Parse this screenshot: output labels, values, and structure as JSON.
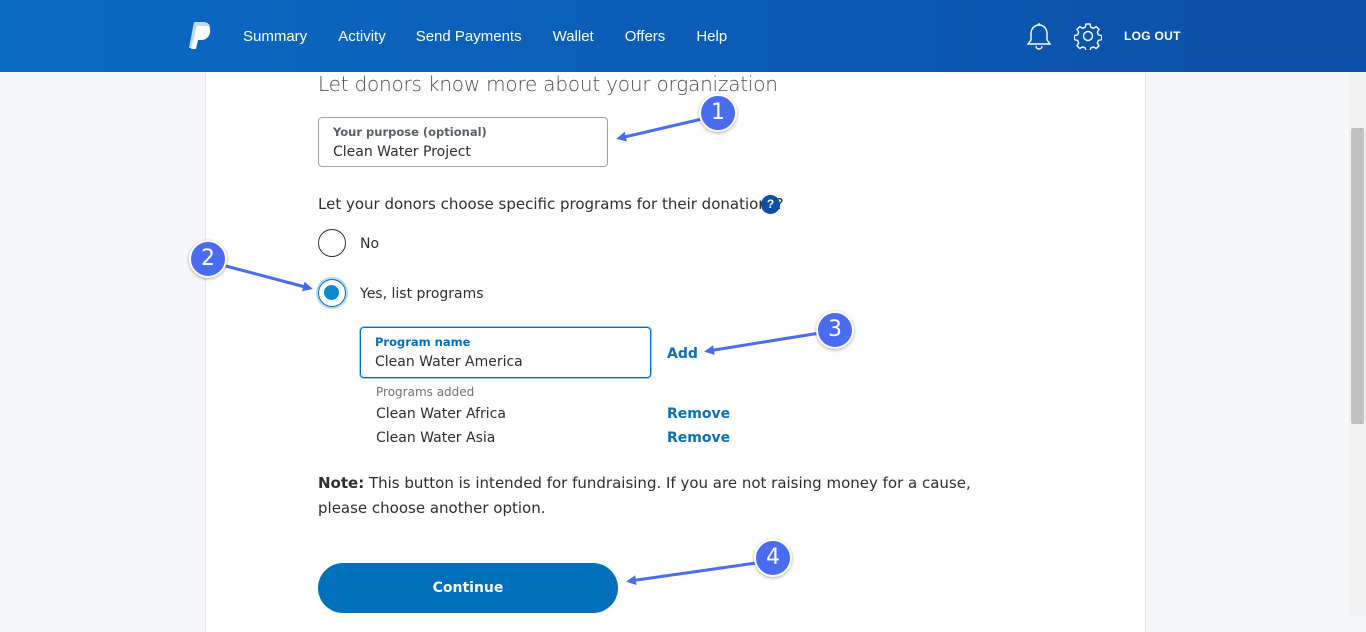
{
  "nav": {
    "items": [
      "Summary",
      "Activity",
      "Send Payments",
      "Wallet",
      "Offers",
      "Help"
    ],
    "logout_label": "LOG OUT",
    "logo_icon": "paypal-logo",
    "bell_icon": "bell-icon",
    "settings_icon": "gear-icon"
  },
  "form": {
    "heading": "Let donors know more about your organization",
    "purpose": {
      "label": "Your purpose (optional)",
      "value": "Clean Water Project"
    },
    "question": "Let your donors choose specific programs for their donations?",
    "help_icon": "?",
    "options": {
      "no": "No",
      "yes": "Yes, list programs",
      "selected": "yes"
    },
    "program": {
      "label": "Program name",
      "value": "Clean Water America",
      "add_label": "Add"
    },
    "programs_added": {
      "title": "Programs added",
      "items": [
        {
          "name": "Clean Water Africa",
          "action": "Remove"
        },
        {
          "name": "Clean Water Asia",
          "action": "Remove"
        }
      ]
    },
    "note": {
      "bold": "Note:",
      "text": " This button is intended for fundraising. If you are not raising money for a cause, please choose another option."
    },
    "continue_label": "Continue"
  },
  "annotations": [
    "1",
    "2",
    "3",
    "4"
  ],
  "colors": {
    "brand_blue": "#0070ba",
    "header_blue": "#0a6bc2",
    "annotation_blue": "#4a6cf0"
  }
}
